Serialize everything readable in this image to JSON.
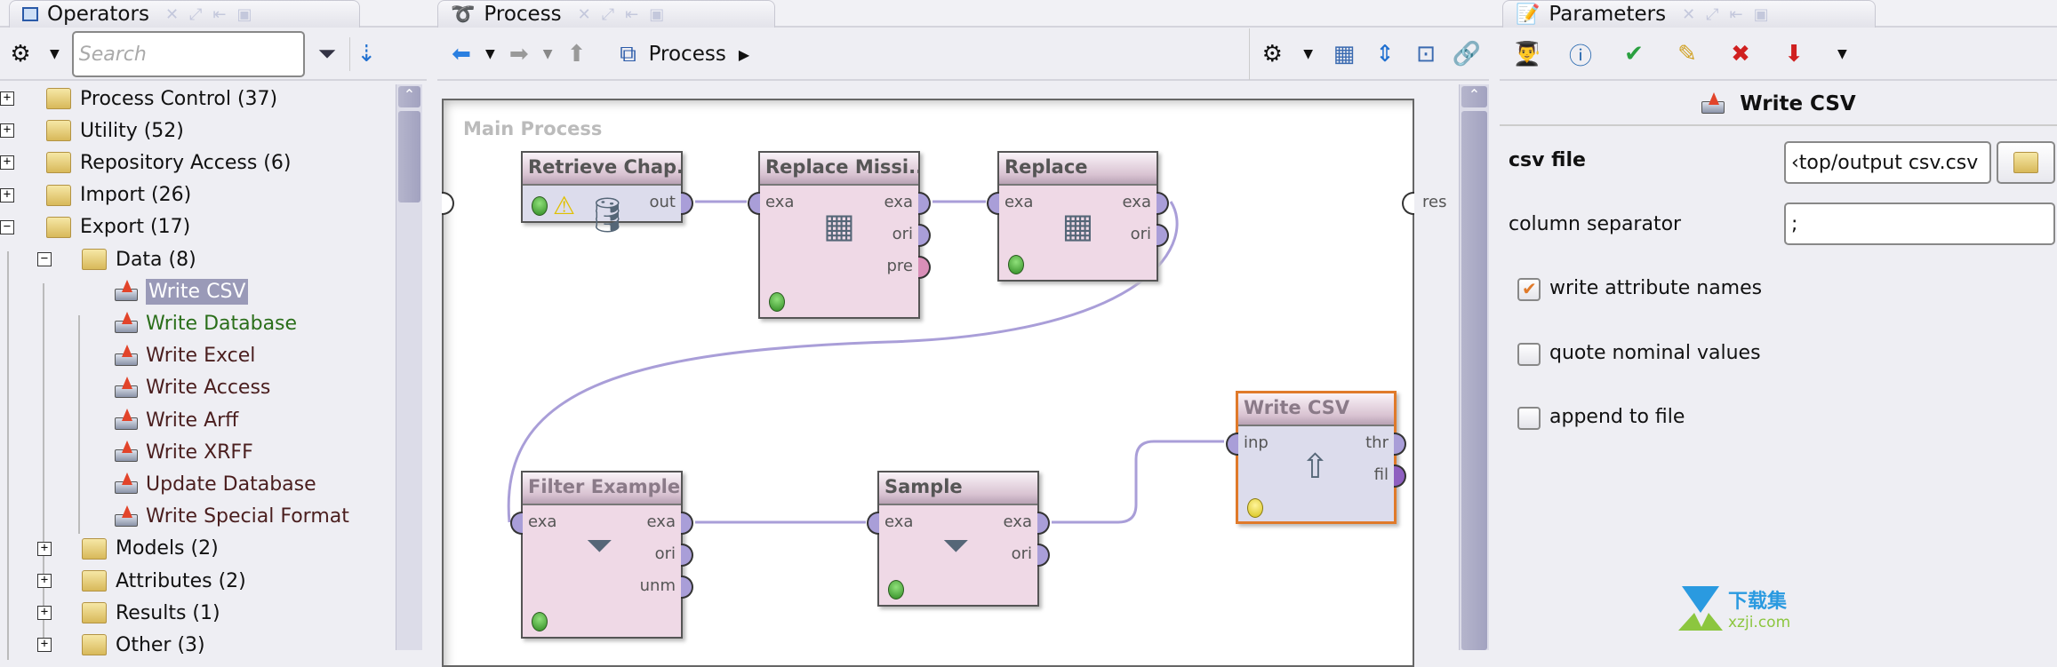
{
  "operators_panel": {
    "tab_title": "Operators",
    "search_placeholder": "Search",
    "tree": [
      {
        "label": "Process Control (37)",
        "expander": "+"
      },
      {
        "label": "Utility (52)",
        "expander": "+"
      },
      {
        "label": "Repository Access (6)",
        "expander": "+"
      },
      {
        "label": "Import (26)",
        "expander": "+"
      },
      {
        "label": "Export (17)",
        "expander": "−"
      },
      {
        "label": "Data (8)",
        "expander": "−"
      },
      {
        "label": "Write CSV",
        "selected": true
      },
      {
        "label": "Write Database"
      },
      {
        "label": "Write Excel"
      },
      {
        "label": "Write Access"
      },
      {
        "label": "Write Arff"
      },
      {
        "label": "Write XRFF"
      },
      {
        "label": "Update Database"
      },
      {
        "label": "Write Special Format"
      },
      {
        "label": "Models (2)",
        "expander": "+"
      },
      {
        "label": "Attributes (2)",
        "expander": "+"
      },
      {
        "label": "Results (1)",
        "expander": "+"
      },
      {
        "label": "Other (3)",
        "expander": "+"
      }
    ]
  },
  "process_panel": {
    "tab_title": "Process",
    "breadcrumb": "Process",
    "canvas_title": "Main Process",
    "result_port": "res",
    "operators": [
      {
        "name": "Retrieve Chap...",
        "in": [],
        "out": [
          "out"
        ],
        "status": "ok",
        "warning": true
      },
      {
        "name": "Replace Missi...",
        "in": [
          "exa"
        ],
        "out": [
          "exa",
          "ori",
          "pre"
        ],
        "status": "ok"
      },
      {
        "name": "Replace",
        "in": [
          "exa"
        ],
        "out": [
          "exa",
          "ori"
        ],
        "status": "ok"
      },
      {
        "name": "Filter Examples",
        "in": [
          "exa"
        ],
        "out": [
          "exa",
          "ori",
          "unm"
        ],
        "status": "ok"
      },
      {
        "name": "Sample",
        "in": [
          "exa"
        ],
        "out": [
          "exa",
          "ori"
        ],
        "status": "ok"
      },
      {
        "name": "Write CSV",
        "in": [
          "inp"
        ],
        "out": [
          "thr",
          "fil"
        ],
        "status": "pending",
        "selected": true
      }
    ]
  },
  "parameters_panel": {
    "tab_title": "Parameters",
    "operator_title": "Write CSV",
    "csv_file_label": "csv file",
    "csv_file_value": "‹top/output csv.csv",
    "column_separator_label": "column separator",
    "column_separator_value": ";",
    "write_attribute_names_label": "write attribute names",
    "write_attribute_names": true,
    "quote_nominal_values_label": "quote nominal values",
    "quote_nominal_values": false,
    "append_to_file_label": "append to file",
    "append_to_file": false
  },
  "watermark": {
    "cn": "下载集",
    "url": "xzji.com"
  },
  "colors": {
    "selected_operator_border": "#e07a2a",
    "port": "#a99ed8",
    "connection": "#a99ed8",
    "tree_selection": "#9a9ab8",
    "tree_green": "#2a6e1a"
  }
}
